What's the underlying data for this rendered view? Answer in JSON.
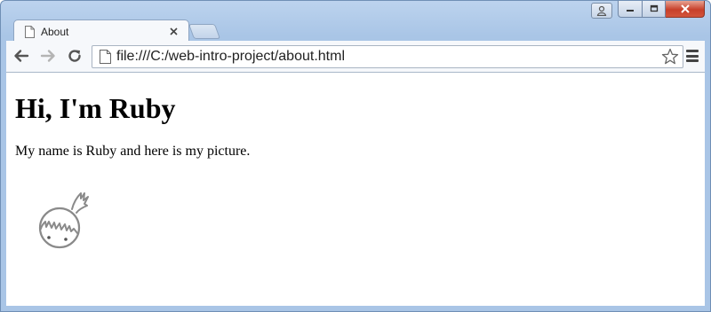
{
  "browser": {
    "tab": {
      "title": "About"
    },
    "address_bar": {
      "url": "file:///C:/web-intro-project/about.html"
    }
  },
  "page": {
    "heading": "Hi, I'm Ruby",
    "paragraph": "My name is Ruby and here is my picture."
  },
  "icons": {
    "back": "back-arrow-icon",
    "forward": "forward-arrow-icon",
    "reload": "reload-icon",
    "page": "page-icon",
    "star": "star-icon",
    "menu": "hamburger-menu-icon"
  },
  "colors": {
    "frame": "#a9c5e6",
    "close_button": "#c7402a"
  }
}
